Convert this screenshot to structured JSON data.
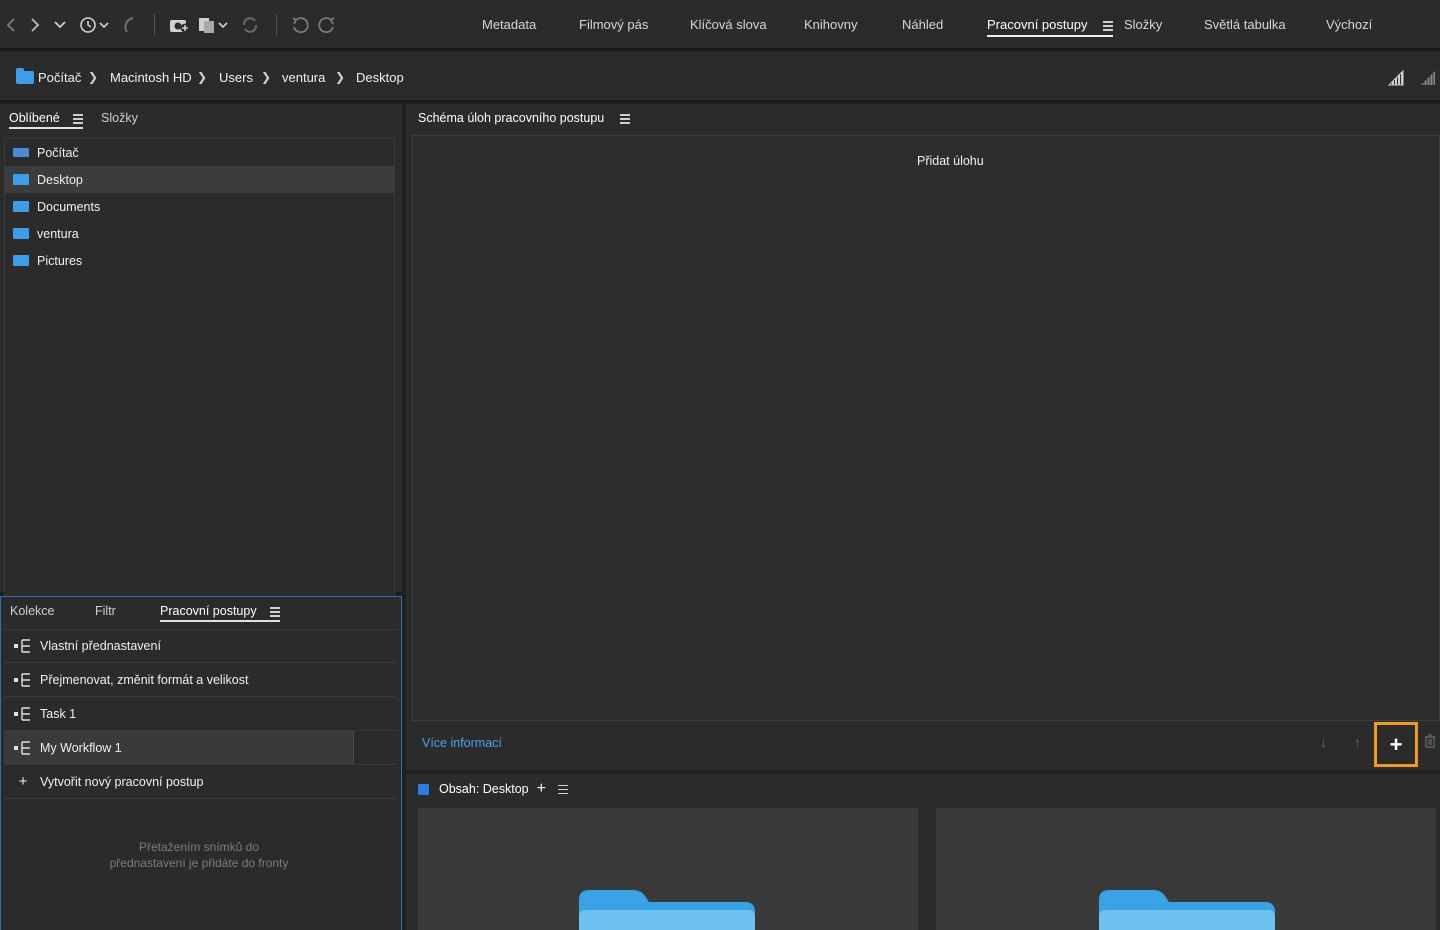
{
  "toolbar": {
    "workspace_tabs": [
      {
        "label": "Metadata"
      },
      {
        "label": "Filmový pás"
      },
      {
        "label": "Klíčová slova"
      },
      {
        "label": "Knihovny"
      },
      {
        "label": "Náhled"
      },
      {
        "label": "Pracovní postupy",
        "active": true
      },
      {
        "label": "Složky"
      },
      {
        "label": "Světlá tabulka"
      },
      {
        "label": "Výchozí"
      }
    ]
  },
  "breadcrumb": [
    "Počítač",
    "Macintosh HD",
    "Users",
    "ventura",
    "Desktop"
  ],
  "left_top": {
    "tabs": [
      "Oblíbené",
      "Složky"
    ],
    "favorites": [
      {
        "label": "Počítač",
        "icon": "computer-icon"
      },
      {
        "label": "Desktop",
        "icon": "folder-icon",
        "selected": true
      },
      {
        "label": "Documents",
        "icon": "folder-icon"
      },
      {
        "label": "ventura",
        "icon": "home-folder-icon"
      },
      {
        "label": "Pictures",
        "icon": "folder-icon"
      }
    ]
  },
  "left_bottom": {
    "tabs": [
      "Kolekce",
      "Filtr",
      "Pracovní postupy"
    ],
    "workflows": [
      {
        "label": "Vlastní přednastavení"
      },
      {
        "label": "Přejmenovat, změnit formát a velikost"
      },
      {
        "label": "Task 1"
      },
      {
        "label": "My Workflow 1",
        "selected": true
      }
    ],
    "create_new": "Vytvořit nový pracovní postup",
    "hint": "Přetažením snímků do přednastavení je přidáte do fronty"
  },
  "workflow_panel": {
    "title": "Schéma úloh pracovního postupu",
    "add_task": "Přidat úlohu",
    "more_info": "Více informací",
    "add_button": "+"
  },
  "content_panel": {
    "title": "Obsah: Desktop",
    "add": "+"
  },
  "colors": {
    "accent_blue": "#2a7de1",
    "link_blue": "#4aa3f2",
    "highlight_orange": "#f39c12",
    "folder_blue": "#3a9fe8"
  }
}
